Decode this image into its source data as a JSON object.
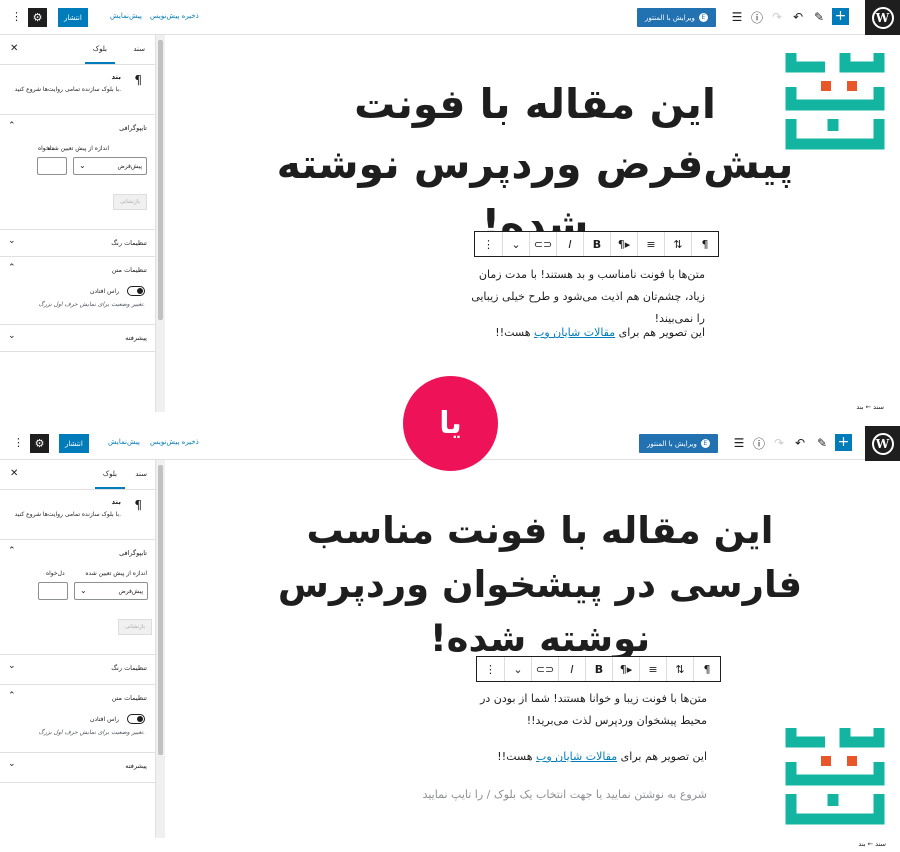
{
  "colors": {
    "accent": "#007cba",
    "badge": "#ee1259",
    "logo": "#13b5a0",
    "logo_dots": "#e8562a"
  },
  "icons": {
    "plus": "plus-icon",
    "pencil": "pencil-icon",
    "undo": "undo-icon",
    "redo": "redo-icon",
    "info": "info-icon",
    "outline": "list-view-icon",
    "gear": "gear-icon",
    "kebab": "kebab-icon"
  },
  "screen1": {
    "top": {
      "edit_elementor": "ویرایش با المنتور",
      "publish": "انتشار",
      "preview": "پیش‌نمایش",
      "save_draft": "ذخیره پیش‌نویس"
    },
    "sidebar": {
      "tab_document": "سند",
      "tab_block": "بلوک",
      "block_title": "بند",
      "block_desc": "با بلوک سازنده تمامی روایت‌ها شروع کنید.",
      "typography": "تایپوگرافی",
      "preset_label": "اندازه از پیش تعیین شده",
      "custom_label": "دلخواه",
      "select_value": "پیش‌فرض",
      "reset": "بازنشانی",
      "color_settings": "تنظیمات رنگ",
      "text_settings": "تنظیمات متن",
      "dropcap_label": "راس افتادن",
      "dropcap_help": "تغییر وضعیت برای نمایش حرف اول بزرگ.",
      "advanced": "پیشرفته"
    },
    "headline": "این مقاله با فونت پیش‌فرض وردپرس نوشته شده!",
    "para1": "متن‌ها با فونت نامناسب و بد هستند! با مدت زمان زیاد، چشم‌تان هم اذیت می‌شود و طرح خیلی زیبایی را نمی‌بیند!",
    "para2_before": "این تصویر هم برای ",
    "para2_link": "مقالات شایان وب",
    "para2_after": " هست!!",
    "breadcrumb": "سند ← بند"
  },
  "screen2": {
    "top": {
      "edit_elementor": "ویرایش با المنتور",
      "publish": "انتشار",
      "preview": "پیش‌نمایش",
      "save_draft": "ذخیره پیش‌نویس"
    },
    "sidebar": {
      "tab_document": "سند",
      "tab_block": "بلوک",
      "block_title": "بند",
      "block_desc": "با بلوک سازنده تمامی روایت‌ها شروع کنید.",
      "typography": "تایپوگرافی",
      "preset_label": "اندازه از پیش تعیین شده",
      "custom_label": "دل‌خواه",
      "select_value": "پیش‌فرض",
      "reset": "بازنشانی",
      "color_settings": "تنظیمات رنگ",
      "text_settings": "تنظیمات متن",
      "dropcap_label": "راس افتادن",
      "dropcap_help": "تغییر وضعیت برای نمایش حرف اول بزرگ.",
      "advanced": "پیشرفته"
    },
    "headline": "این مقاله با فونت مناسب فارسی در پیشخوان وردپرس نوشته شده!",
    "para1": "متن‌ها با فونت زیبا و خوانا هستند! شما از بودن در محیط پیشخوان وردپرس لذت می‌برید!!",
    "para2_before": "این تصویر هم برای ",
    "para2_link": "مقالات شایان وب",
    "para2_after": " هست!!",
    "placeholder": "شروع به نوشتن نمایید یا جهت انتخاب یک بلوک / را تایپ نمایید",
    "breadcrumb": "سند ← بند"
  },
  "badge_text": "یا",
  "toolbar": {
    "pilcrow": "¶",
    "align": "align-icon",
    "moveup": "move-up-icon",
    "bold": "B",
    "italic": "I",
    "link": "link-icon",
    "more": "chevron-down-icon",
    "options": "kebab-icon"
  }
}
